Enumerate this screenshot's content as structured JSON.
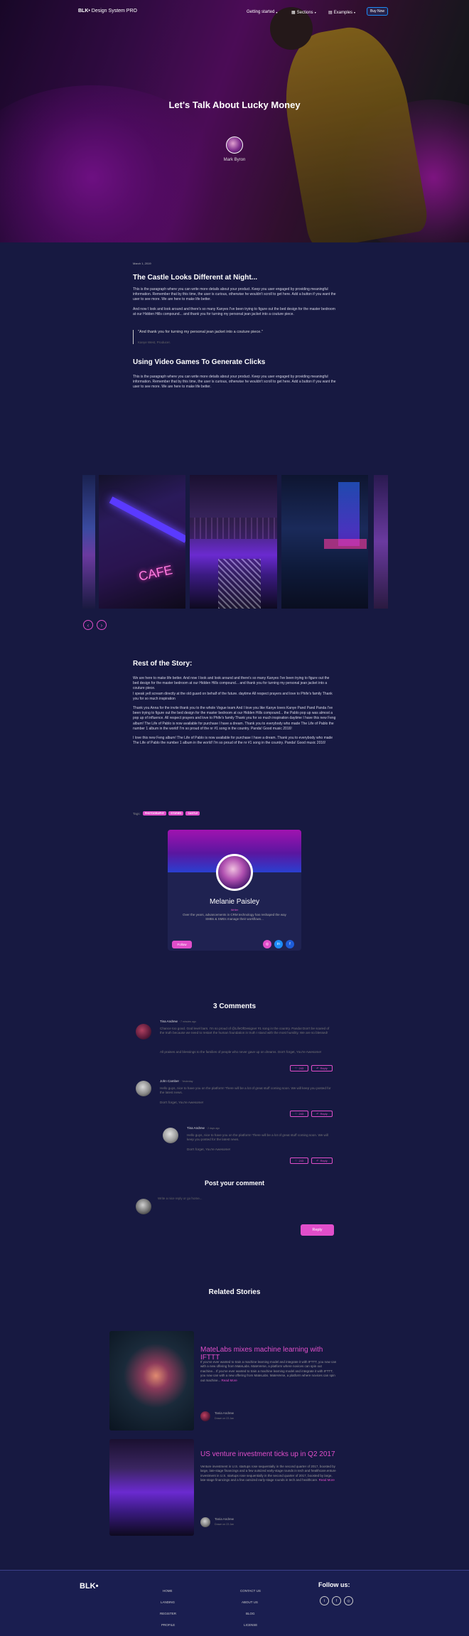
{
  "nav": {
    "brand_bold": "BLK•",
    "brand_rest": " Design System PRO",
    "getting_started": "Getting started",
    "sections": "Sections",
    "examples": "Examples",
    "buy_now": "Buy Now"
  },
  "hero": {
    "title": "Let's Talk About Lucky Money",
    "author": "Mark Byron"
  },
  "article": {
    "date": "March 1, 2019",
    "heading1": "The Castle Looks Different at Night...",
    "para1": "This is the paragraph where you can write more details about your product. Keep you user engaged by providing meaningful information. Remember that by this time, the user is curious, otherwise he wouldn't scroll to get here. Add a button if you want the user to see more. We are here to make life better.",
    "para2": "And now I look and look around and there's so many Kanyes I've been trying to figure out the bed design for the master bedroom at our Hidden Hills compound... and thank you for turning my personal jean jacket into a couture piece.",
    "quote": "\"And thank you for turning my personal jean jacket into a couture piece.\"",
    "quote_author": "Kanye West, Producer.",
    "heading2": "Using Video Games To Generate Clicks",
    "para3": "This is the paragraph where you can write more details about your product. Keep you user engaged by providing meaningful information. Remember that by this time, the user is curious, otherwise he wouldn't scroll to get here. Add a button if you want the user to see more. We are here to make life better."
  },
  "gallery": {
    "prev": "‹",
    "next": "›",
    "sign": "CAFE"
  },
  "story": {
    "heading": "Rest of the Story:",
    "para1": "We are here to make life better. And now I look and look around and there's so many Kanyes I've been trying to figure out the bed design for the master bedroom at our Hidden Hills compound... and thank you for turning my personal jean jacket into a couture piece.",
    "para1b": "I speak yell scream directly at the old guard on behalf of the future. daytime All respect prayers and love to Phife's family Thank you for so much inspiration",
    "para2": "Thank you Anna for the invite thank you to the whole Vogue team And I love you like Kanye loves Kanye Pand Pand Panda I've been trying to figure out the bed design for the master bedroom at our Hidden Hills compound... the Pablo pop up was almost a pop up of influence. All respect prayers and love to Phife's family Thank you for so much inspiration daytime I have this new Feng album! The Life of Pablo is now available for purchase I have a dream. Thank you to everybody who made The Life of Pablo the number 1 album in the world! I'm so proud of the nr #1 song in the country. Panda! Good music 2016!",
    "para3": "I love this new Feng album! The Life of Pablo is now available for purchase I have a dream. Thank you to everybody who made The Life of Pablo the number 1 album in the world! I'm so proud of the nr #1 song in the country. Panda! Good music 2016!"
  },
  "tags": {
    "label": "Tags:",
    "items": [
      "PHOTOGRAPHY",
      "STORIES",
      "CASTLE"
    ]
  },
  "profile": {
    "name": "Melanie Paisley",
    "role": "Writer",
    "desc": "Over the years, advancements in CRM technology has reshaped the way SMBs & SMEs manage their workflows...",
    "follow": "Follow"
  },
  "comments": {
    "title": "3 Comments",
    "items": [
      {
        "name": "Tina Andrew",
        "time": "· 7 minutes ago",
        "text": "Chance too good. God level bars. I'm so proud of @LifeOfDesigner #1 song in the country. Panda! Don't be scared of the truth because we need to restart the human foundation in truth I stand with the most humility. We are so blessed!",
        "text2": "All praises and blessings to the families of people who never gave up on dreams. Don't forget, You're Awesome!",
        "likes": "243",
        "reply": "Reply"
      },
      {
        "name": "John Camber",
        "time": "· Yesterday",
        "text": "Hello guys, nice to have you on the platform! There will be a lot of great stuff coming soon. We will keep you posted for the latest news.",
        "text2": "Don't forget, You're Awesome!",
        "likes": "243",
        "reply": "Reply"
      },
      {
        "name": "Tina Andrew",
        "time": "· 2 days ago",
        "text": "Hello guys, nice to have you on the platform! There will be a lot of great stuff coming soon. We will keep you posted for the latest news.",
        "text2": "Don't forget, You're Awesome!",
        "likes": "243",
        "reply": "Reply"
      }
    ]
  },
  "post": {
    "title": "Post your comment",
    "placeholder": "Write a nice reply or go home...",
    "reply": "Reply"
  },
  "related": {
    "title": "Related Stories",
    "items": [
      {
        "title": "MateLabs mixes machine learning with IFTTT",
        "text": "If you've ever wanted to train a machine learning model and integrate it with IFTTT, you now can with a new offering from MateLabs. MateVerse, a platform where novices can spin out machine... If you've ever wanted to train a machine learning model and integrate it with IFTTT, you now can with a new offering from MateLabs. MateVerse, a platform where novices can spin out machine...",
        "more": "Read More",
        "author": "Tania Andrew",
        "time": "Drawn on 23 Jan"
      },
      {
        "title": "US venture investment ticks up in Q2 2017",
        "text": "Venture investment in U.S. startups rose sequentially in the second quarter of 2017, boosted by large, late-stage financings and a few outsized early-stage rounds in tech and healthcare.enture investment in U.S. startups rose sequentially in the second quarter of 2017, boosted by large, late-stage financings and a few outsized early-stage rounds in tech and healthcare.",
        "more": "Read More",
        "author": "Tania Andrew",
        "time": "Drawn on 23 Jan"
      }
    ]
  },
  "footer": {
    "brand": "BLK•",
    "col1": [
      "HOME",
      "LANDING",
      "REGISTER",
      "PROFILE"
    ],
    "col2": [
      "CONTACT US",
      "ABOUT US",
      "BLOG",
      "LICENSE"
    ],
    "follow": "Follow us:"
  },
  "colors": {
    "background": "#171941",
    "accent": "#e14eca",
    "info": "#1d8cf8"
  }
}
